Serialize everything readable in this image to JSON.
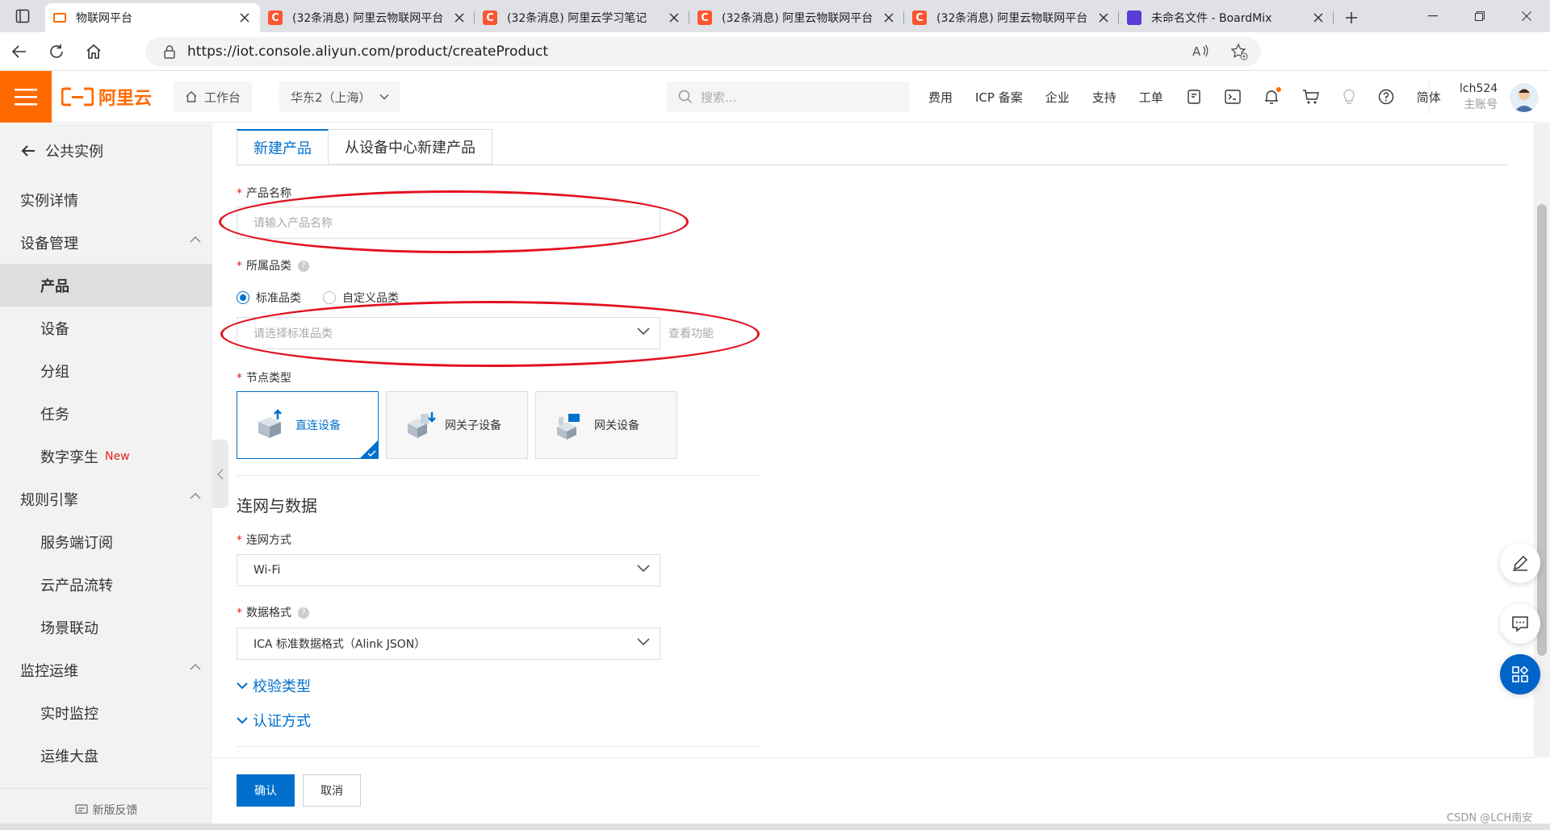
{
  "browser": {
    "tabs": [
      {
        "title": "物联网平台",
        "active": true,
        "favicon": "aliyun-logo-icon"
      },
      {
        "title": "(32条消息) 阿里云物联网平台",
        "active": false,
        "favicon": "csdn-logo-icon"
      },
      {
        "title": "(32条消息) 阿里云学习笔记",
        "active": false,
        "favicon": "csdn-logo-icon"
      },
      {
        "title": "(32条消息) 阿里云物联网平台",
        "active": false,
        "favicon": "csdn-logo-icon"
      },
      {
        "title": "(32条消息) 阿里云物联网平台",
        "active": false,
        "favicon": "csdn-logo-icon"
      },
      {
        "title": "未命名文件 - BoardMix",
        "active": false,
        "favicon": "boardmix-logo-icon"
      }
    ],
    "url": "https://iot.console.aliyun.com/product/createProduct"
  },
  "header": {
    "logo_text": "阿里云",
    "workbench": "工作台",
    "region": "华东2（上海）",
    "search_placeholder": "搜索...",
    "nav": [
      "费用",
      "ICP 备案",
      "企业",
      "支持",
      "工单"
    ],
    "lang": "简体",
    "username": "lch524",
    "account_type": "主账号"
  },
  "sidebar": {
    "back_label": "公共实例",
    "items": [
      {
        "label": "实例详情",
        "level": "group"
      },
      {
        "label": "设备管理",
        "level": "group",
        "expanded": true
      },
      {
        "label": "产品",
        "level": "sub",
        "selected": true
      },
      {
        "label": "设备",
        "level": "sub"
      },
      {
        "label": "分组",
        "level": "sub"
      },
      {
        "label": "任务",
        "level": "sub"
      },
      {
        "label": "数字孪生",
        "level": "sub",
        "badge": "New"
      },
      {
        "label": "规则引擎",
        "level": "group",
        "expanded": true
      },
      {
        "label": "服务端订阅",
        "level": "sub"
      },
      {
        "label": "云产品流转",
        "level": "sub"
      },
      {
        "label": "场景联动",
        "level": "sub"
      },
      {
        "label": "监控运维",
        "level": "group",
        "expanded": true
      },
      {
        "label": "实时监控",
        "level": "sub"
      },
      {
        "label": "运维大盘",
        "level": "sub"
      }
    ],
    "feedback": "新版反馈"
  },
  "form": {
    "tabs": [
      "新建产品",
      "从设备中心新建产品"
    ],
    "product_name": {
      "label": "产品名称",
      "placeholder": "请输入产品名称"
    },
    "category": {
      "label": "所属品类",
      "options": [
        "标准品类",
        "自定义品类"
      ],
      "selected": "标准品类",
      "placeholder": "请选择标准品类",
      "view_features": "查看功能"
    },
    "node_type": {
      "label": "节点类型",
      "cards": [
        "直连设备",
        "网关子设备",
        "网关设备"
      ],
      "selected": "直连设备"
    },
    "section_network": "连网与数据",
    "network_mode": {
      "label": "连网方式",
      "value": "Wi-Fi"
    },
    "data_format": {
      "label": "数据格式",
      "value": "ICA 标准数据格式（Alink JSON）"
    },
    "verify_type": "校验类型",
    "auth_method": "认证方式"
  },
  "footer": {
    "confirm": "确认",
    "cancel": "取消"
  },
  "watermark": "CSDN @LCH南安",
  "colors": {
    "brand": "#ff6a00",
    "primary": "#0070cc",
    "annotation": "#e3101e"
  }
}
